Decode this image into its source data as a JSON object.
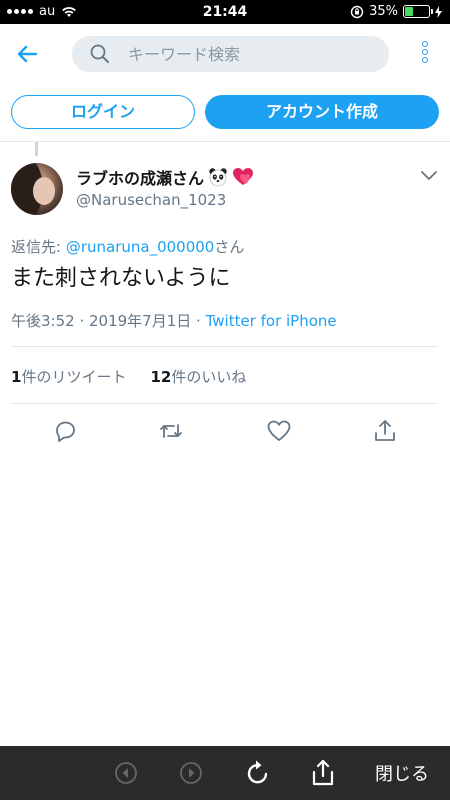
{
  "status_bar": {
    "carrier": "au",
    "time": "21:44",
    "battery_percent": "35%",
    "battery_level": 0.35
  },
  "header": {
    "search_placeholder": "キーワード検索"
  },
  "auth": {
    "login_label": "ログイン",
    "signup_label": "アカウント作成"
  },
  "tweet": {
    "display_name": "ラブホの成瀬さん",
    "handle": "@Narusechan_1023",
    "reply_prefix": "返信先: ",
    "reply_user": "@runaruna_000000",
    "reply_suffix": "さん",
    "text": "また刺されないように",
    "time": "午後3:52",
    "separator": " · ",
    "date": "2019年7月1日",
    "source": "Twitter for iPhone",
    "retweet_count": "1",
    "retweet_label": "件のリツイート",
    "like_count": "12",
    "like_label": "件のいいね"
  },
  "toolbar": {
    "close_label": "閉じる"
  },
  "colors": {
    "accent": "#1da1f2",
    "muted": "#657786",
    "toolbar_bg": "#2b2b2b"
  },
  "icons": [
    "back-arrow-icon",
    "search-icon",
    "more-icon",
    "panda-icon",
    "heart-icon",
    "chevron-down-icon",
    "reply-icon",
    "retweet-icon",
    "like-icon",
    "share-icon",
    "browser-back-icon",
    "browser-forward-icon",
    "reload-icon",
    "browser-share-icon"
  ]
}
